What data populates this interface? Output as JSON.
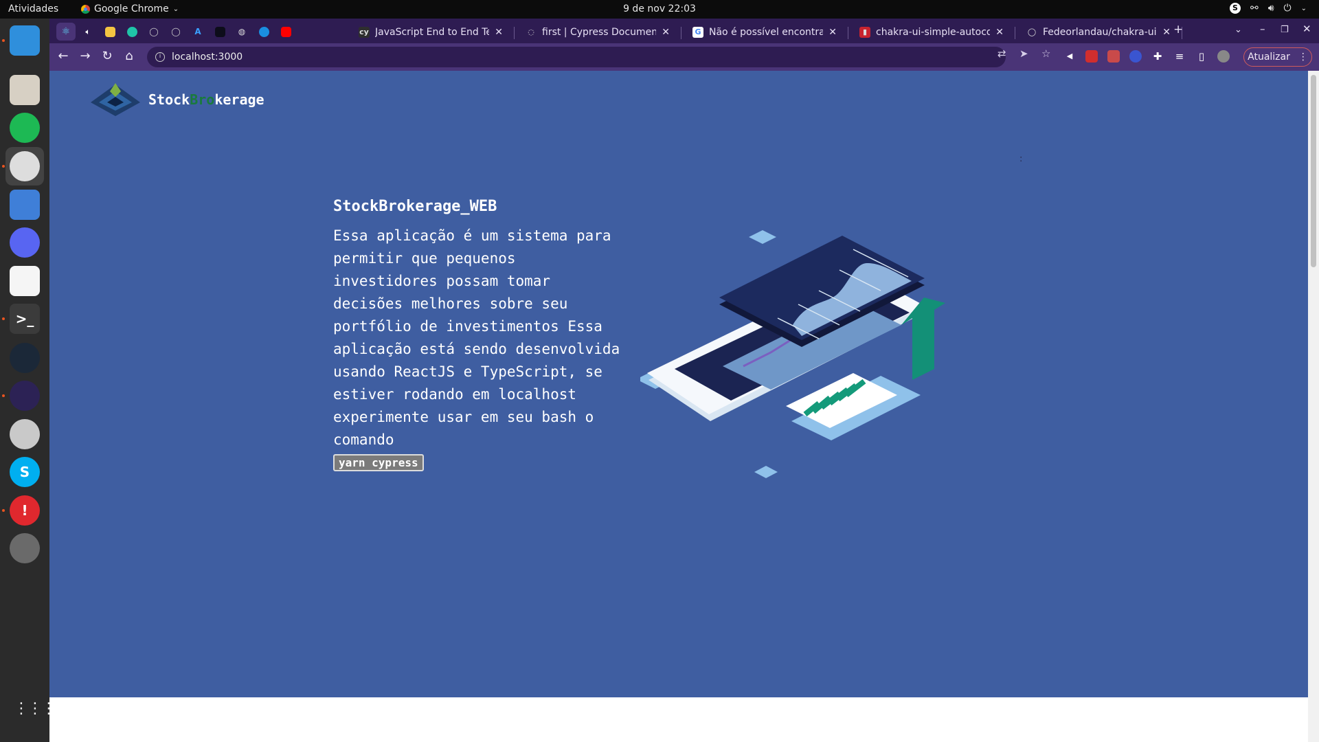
{
  "topbar": {
    "activities": "Atividades",
    "app_name": "Google Chrome",
    "clock": "9 de nov  22:03"
  },
  "dock": {
    "items": [
      {
        "name": "vscode",
        "label": "",
        "color": "#2f8fdc"
      },
      {
        "name": "files",
        "label": "",
        "color": "#d7d0c4"
      },
      {
        "name": "spotify",
        "label": "",
        "color": "#1db954"
      },
      {
        "name": "chrome",
        "label": "",
        "color": "#dddddd"
      },
      {
        "name": "screenshot",
        "label": "",
        "color": "#3f7fd8"
      },
      {
        "name": "discord",
        "label": "",
        "color": "#5865f2"
      },
      {
        "name": "text-editor",
        "label": "",
        "color": "#f5f5f5"
      },
      {
        "name": "terminal",
        "label": ">_",
        "color": "#3b3b3b"
      },
      {
        "name": "steam",
        "label": "",
        "color": "#1b2838"
      },
      {
        "name": "eclipse",
        "label": "",
        "color": "#2c2255"
      },
      {
        "name": "search",
        "label": "",
        "color": "#c9c9c9"
      },
      {
        "name": "skype",
        "label": "S",
        "color": "#00aff0"
      },
      {
        "name": "alert",
        "label": "!",
        "color": "#e0282e"
      },
      {
        "name": "software-updater",
        "label": "",
        "color": "#6a6a6a"
      }
    ],
    "grid_label": "⋮⋮⋮"
  },
  "tabs": [
    {
      "title": "JavaScript End to End Te",
      "fav": "#2e2e2e",
      "favtext": "cy"
    },
    {
      "title": "first | Cypress Documenta",
      "fav": "#2e1c52",
      "favtext": "◌"
    },
    {
      "title": "Não é possível encontrar",
      "fav": "#ffffff",
      "favtext": "G"
    },
    {
      "title": "chakra-ui-simple-autocom",
      "fav": "#c9242f",
      "favtext": "▮"
    },
    {
      "title": "Fedeorlandau/chakra-ui-",
      "fav": "#2e1c52",
      "favtext": "◯"
    }
  ],
  "toolbar": {
    "url": "localhost:3000",
    "update_label": "Atualizar"
  },
  "page": {
    "brand_pre": "Stock",
    "brand_mid": "Bro",
    "brand_post": "kerage",
    "title": "StockBrokerage_WEB",
    "description": "Essa aplicação é um sistema para permitir que pequenos investidores possam tomar decisões melhores sobre seu portfólio de investimentos Essa aplicação está sendo desenvolvida usando ReactJS e TypeScript, se estiver rodando em localhost experimente usar em seu bash o comando",
    "command": "yarn cypress",
    "dot_marker": ":"
  },
  "colors": {
    "hero_bg": "#3f5ea1",
    "brand_green": "#1a7a3d",
    "tab_strip": "#2e1c52",
    "toolbar": "#4a3477"
  }
}
